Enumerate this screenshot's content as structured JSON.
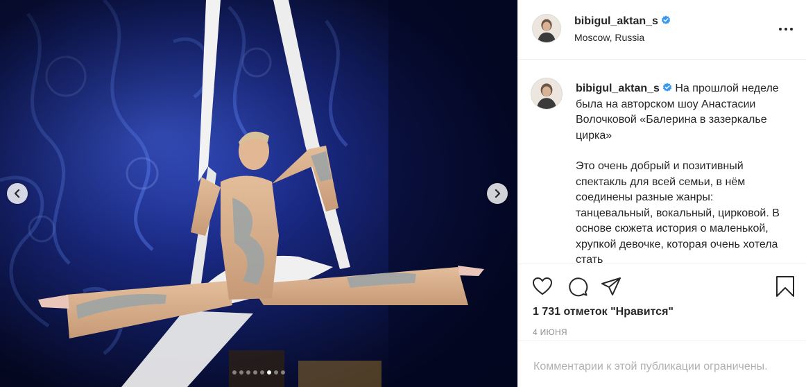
{
  "post": {
    "username": "bibigul_aktan_s",
    "location": "Moscow, Russia",
    "caption_paragraphs": [
      "На прошлой неделе была на авторском шоу Анастасии Волочковой «Балерина в зазеркалье цирка»",
      "Это очень добрый и позитивный спектакль для всей семьи, в нём соединены разные жанры: танцевальный, вокальный, цирковой. В основе сюжета история о маленькой, хрупкой девочке, которая очень хотела стать"
    ],
    "likes_text": "1 731 отметок \"Нравится\"",
    "date_text": "4 ИЮНЯ",
    "comments_disabled_text": "Комментарии к этой публикации ограничены."
  },
  "carousel": {
    "slide_count": 8,
    "active_index": 5
  },
  "icons": {
    "verified": "verified-badge-icon",
    "more": "more-options-icon",
    "like": "heart-icon",
    "comment": "comment-icon",
    "share": "paper-plane-icon",
    "save": "bookmark-icon",
    "prev": "chevron-left-icon",
    "next": "chevron-right-icon"
  },
  "colors": {
    "verified": "#3897f0",
    "text": "#262626",
    "muted": "#8e8e8e",
    "divider": "#efefef"
  }
}
